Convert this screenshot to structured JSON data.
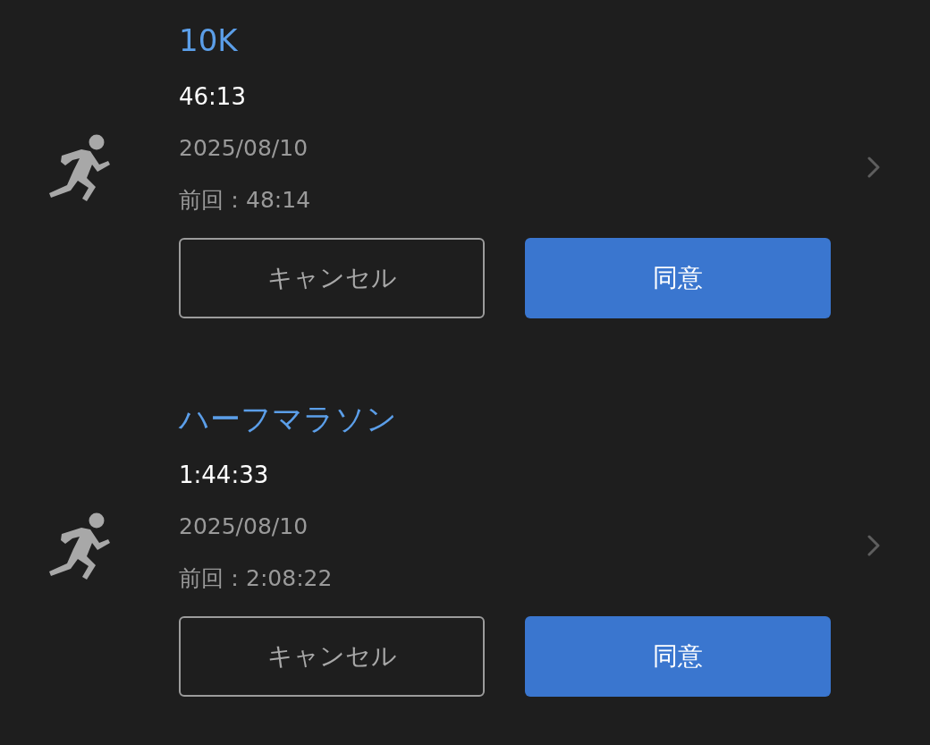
{
  "records": [
    {
      "title": "10K",
      "time": "46:13",
      "date": "2025/08/10",
      "previous": "前回：48:14",
      "buttons": [
        {
          "label": "キャンセル",
          "kind": "outline"
        },
        {
          "label": "同意",
          "kind": "primary"
        }
      ]
    },
    {
      "title": "ハーフマラソン",
      "time": "1:44:33",
      "date": "2025/08/10",
      "previous": "前回：2:08:22",
      "buttons": [
        {
          "label": "キャンセル",
          "kind": "outline"
        },
        {
          "label": "同意",
          "kind": "primary"
        }
      ]
    }
  ]
}
